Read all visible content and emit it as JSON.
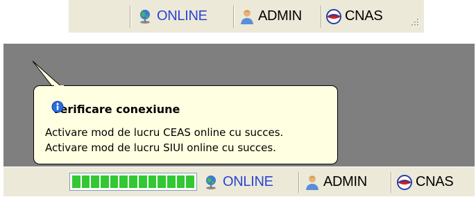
{
  "top_status": {
    "online_label": "ONLINE",
    "admin_label": "ADMIN",
    "cnas_label": "CNAS"
  },
  "balloon": {
    "title": "Verificare conexiune",
    "line1": "Activare mod de lucru CEAS online cu succes.",
    "line2": "Activare mod de lucru SIUI online cu succes."
  },
  "bottom_status": {
    "progress_fraction": 1.0,
    "online_label": "ONLINE",
    "admin_label": "ADMIN",
    "cnas_label": "CNAS"
  },
  "icons": [
    "globe-icon",
    "user-icon",
    "cnas-logo-icon",
    "info-icon",
    "size-grip-icon"
  ],
  "colors": {
    "statusbar": "#ece9d8",
    "online_text": "#2a44d6",
    "balloon_bg": "#ffffe1",
    "panel_bg": "#7f7f7f",
    "progress_fill": "#32c832"
  }
}
